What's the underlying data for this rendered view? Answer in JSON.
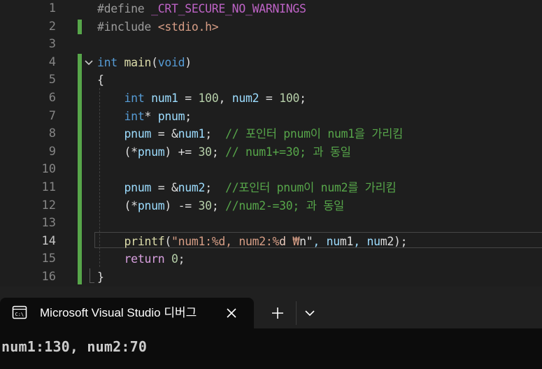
{
  "editor": {
    "lines": [
      {
        "n": "1",
        "t": "#define _CRT_SECURE_NO_WARNINGS"
      },
      {
        "n": "2",
        "t": "#include <stdio.h>"
      },
      {
        "n": "3",
        "t": ""
      },
      {
        "n": "4",
        "t": "int main(void)"
      },
      {
        "n": "5",
        "t": "{"
      },
      {
        "n": "6",
        "t": "    int num1 = 100, num2 = 100;"
      },
      {
        "n": "7",
        "t": "    int* pnum;"
      },
      {
        "n": "8",
        "t": "    pnum = &num1;  // 포인터 pnum이 num1을 가리킴"
      },
      {
        "n": "9",
        "t": "    (*pnum) += 30; // num1+=30; 과 동일"
      },
      {
        "n": "10",
        "t": ""
      },
      {
        "n": "11",
        "t": "    pnum = &num2;  //포인터 pnum이 num2를 가리킴"
      },
      {
        "n": "12",
        "t": "    (*pnum) -= 30; //num2-=30; 과 동일"
      },
      {
        "n": "13",
        "t": ""
      },
      {
        "n": "14",
        "t": "    printf(\"num1:%d, num2:%d ₩n\", num1, num2);"
      },
      {
        "n": "15",
        "t": "    return 0;"
      },
      {
        "n": "16",
        "t": "}"
      }
    ],
    "current_line": "14"
  },
  "terminal": {
    "tab_title": "Microsoft Visual Studio 디버그",
    "output": "num1:130, num2:70"
  },
  "icons": {
    "fold": "chevron-down-icon",
    "tab": "console-icon",
    "close": "close-icon",
    "new_tab": "plus-icon",
    "dropdown": "chevron-down-icon"
  },
  "colors": {
    "keyword": "#569cd6",
    "comment": "#57a64a",
    "string": "#d69d85",
    "macro": "#bd63c5",
    "function": "#dcdcaa",
    "variable": "#9cdcfe",
    "change_bar": "#57a64a"
  }
}
